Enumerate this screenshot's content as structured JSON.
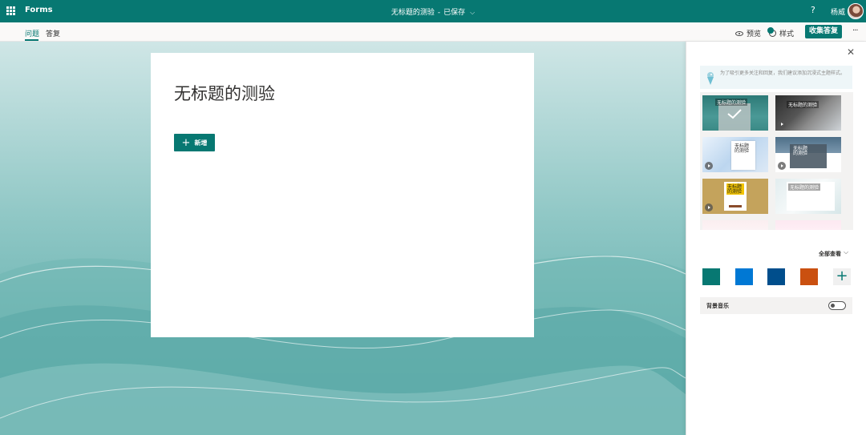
{
  "app": {
    "name": "Forms"
  },
  "document": {
    "title": "无标题的测验",
    "separator": "-",
    "status": "已保存"
  },
  "topbar": {
    "help": "?",
    "user_name": "杨威"
  },
  "tabs": [
    {
      "label": "问题",
      "active": true
    },
    {
      "label": "答复",
      "active": false
    }
  ],
  "commands": {
    "preview": "预览",
    "style": "样式",
    "collect": "收集答复",
    "more": "···"
  },
  "form": {
    "title": "无标题的测验",
    "add_button": "新增"
  },
  "panel": {
    "tip": "为了吸引更多关注和回复，我们建议添加沉浸式主题样式。",
    "themes": [
      {
        "label": "无标题的测验",
        "video": false
      },
      {
        "label": "无标题的测验",
        "video": true
      },
      {
        "label": "无标题的测验",
        "video": true
      },
      {
        "label": "无标题的测验",
        "video": true
      },
      {
        "label": "无标题的测验",
        "video": true
      },
      {
        "label": "无标题的测验",
        "video": false
      }
    ],
    "see_all": "全部查看",
    "colors": [
      "#077872",
      "#0078d4",
      "#004e8c",
      "#ca5010"
    ],
    "background_music": "背景音乐",
    "background_music_on": false
  },
  "colors": {
    "brand": "#077872"
  }
}
